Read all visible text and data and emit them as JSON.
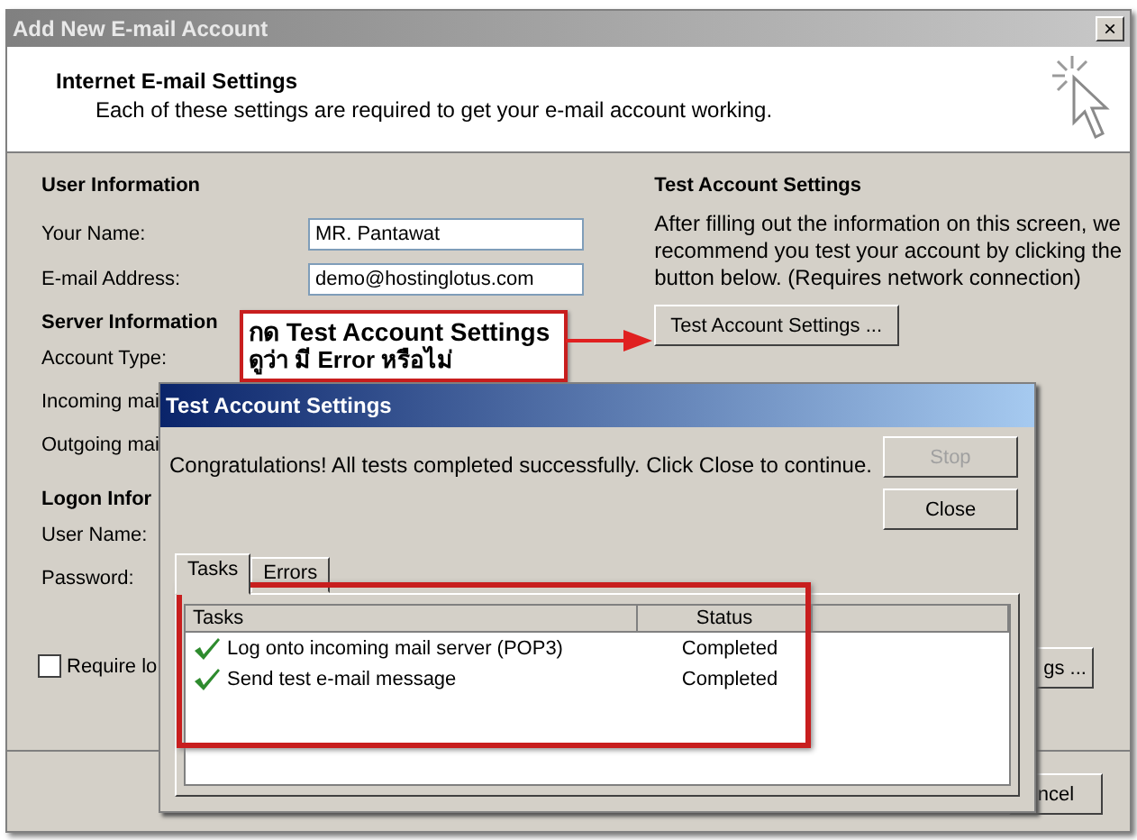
{
  "window": {
    "title": "Add New E-mail Account",
    "close": "×"
  },
  "header": {
    "title": "Internet E-mail Settings",
    "subtitle": "Each of these settings are required to get your e-mail account working."
  },
  "user_information": {
    "heading": "User Information",
    "fields": [
      {
        "label": "Your Name:",
        "value": "MR. Pantawat"
      },
      {
        "label": "E-mail Address:",
        "value": "demo@hostinglotus.com"
      }
    ]
  },
  "server_information": {
    "heading": "Server Information",
    "labels": [
      "Account Type:",
      "Incoming mai",
      "Outgoing mai"
    ]
  },
  "logon_information": {
    "heading": "Logon Infor",
    "labels": [
      "User Name:",
      "Password:"
    ]
  },
  "require_logon": {
    "label": "Require lo",
    "checked": false
  },
  "test_account_settings": {
    "heading": "Test Account Settings",
    "description": "After filling out the information on this screen, we recommend you test your account by clicking the button below. (Requires network connection)",
    "button": "Test Account Settings ..."
  },
  "more_settings_button": "gs ...",
  "cancel_button": "ncel",
  "annotation": {
    "lines": [
      "กด Test Account Settings",
      "ดูว่า มี Error หรือไม่"
    ]
  },
  "dialog": {
    "title": "Test Account Settings",
    "message": "Congratulations! All tests completed successfully. Click Close to continue.",
    "buttons": [
      {
        "label": "Stop",
        "disabled": true
      },
      {
        "label": "Close",
        "disabled": false
      }
    ],
    "tabs": [
      {
        "label": "Tasks",
        "selected": true
      },
      {
        "label": "Errors",
        "selected": false
      }
    ],
    "columns": [
      "Tasks",
      "Status"
    ],
    "rows": [
      {
        "task": "Log onto incoming mail server (POP3)",
        "status": "Completed",
        "done": true
      },
      {
        "task": "Send test e-mail message",
        "status": "Completed",
        "done": true
      }
    ]
  }
}
